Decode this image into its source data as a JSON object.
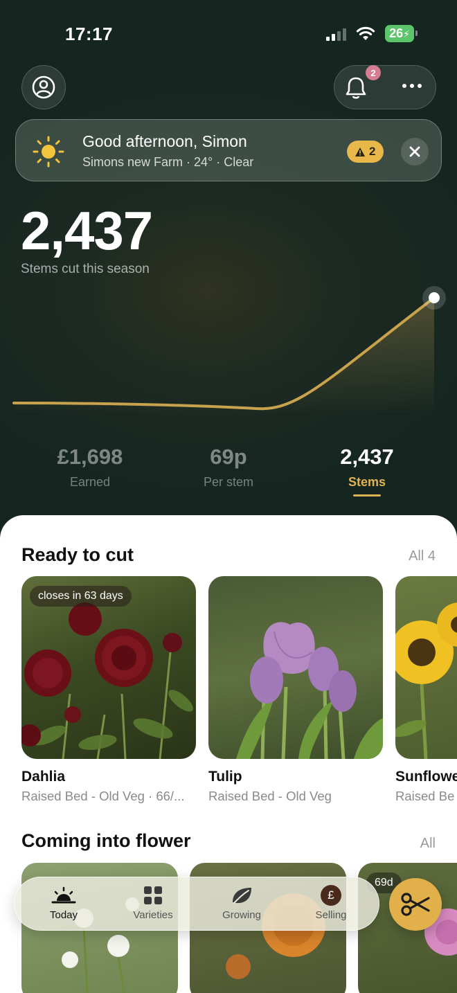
{
  "status_bar": {
    "time": "17:17",
    "battery": "26"
  },
  "header": {
    "notification_count": "2"
  },
  "greeting": {
    "title": "Good afternoon, Simon",
    "subtitle": "Simons new Farm · 24° · Clear",
    "warning_count": "2"
  },
  "hero": {
    "value": "2,437",
    "caption": "Stems cut this season"
  },
  "stats": [
    {
      "value": "£1,698",
      "label": "Earned"
    },
    {
      "value": "69p",
      "label": "Per stem"
    },
    {
      "value": "2,437",
      "label": "Stems"
    }
  ],
  "ready": {
    "title": "Ready to cut",
    "link": "All 4",
    "cards": [
      {
        "name": "Dahlia",
        "location": "Raised Bed - Old Veg · 66/...",
        "chip": "closes in 63 days"
      },
      {
        "name": "Tulip",
        "location": "Raised Bed - Old Veg"
      },
      {
        "name": "Sunflowe",
        "location": "Raised Be"
      }
    ]
  },
  "coming": {
    "title": "Coming into flower",
    "link": "All",
    "chip": "69d"
  },
  "tabs": [
    {
      "label": "Today"
    },
    {
      "label": "Varieties"
    },
    {
      "label": "Growing"
    },
    {
      "label": "Selling"
    }
  ],
  "colors": {
    "accent": "#e0b455",
    "dark_bg": "#182820",
    "fab": "#e2b04a"
  }
}
